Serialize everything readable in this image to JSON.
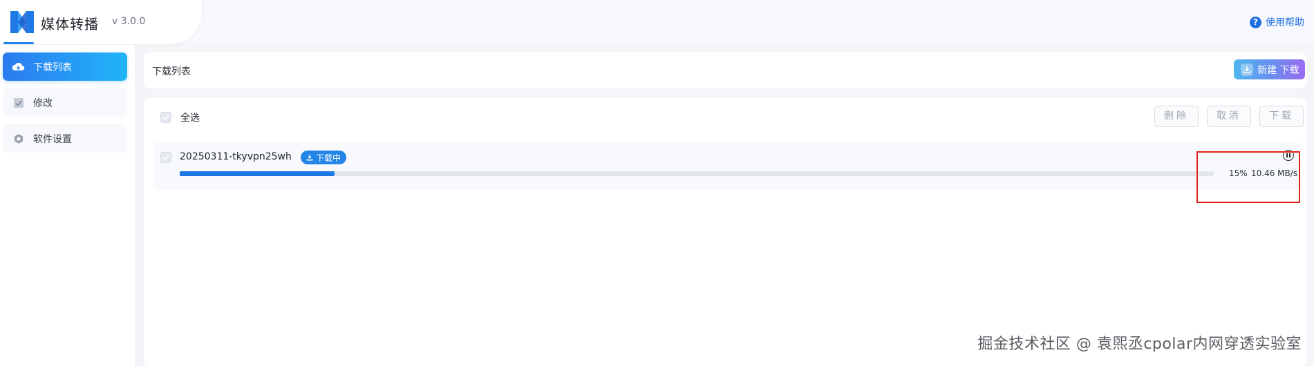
{
  "app": {
    "name": "媒体转播",
    "version": "v 3.0.0",
    "help_label": "使用帮助",
    "accent_color": "#1c86ee"
  },
  "sidebar": {
    "items": [
      {
        "label": "下载列表",
        "icon": "cloud-download-icon",
        "active": true
      },
      {
        "label": "修改",
        "icon": "edit-box-icon",
        "active": false
      },
      {
        "label": "软件设置",
        "icon": "gear-icon",
        "active": false
      }
    ]
  },
  "main": {
    "title": "下载列表",
    "new_download_label": "新建 下载",
    "select_all_label": "全选",
    "actions": {
      "delete_label": "删除",
      "cancel_label": "取消",
      "download_label": "下载"
    },
    "downloads": [
      {
        "name": "20250311-tkyvpn25wh",
        "status": "下载中",
        "progress_percent": 15,
        "progress_label": "15%",
        "speed": "10.46 MB/s"
      }
    ]
  },
  "watermark": "掘金技术社区 @ 袁煕丞cpolar内网穿透实验室"
}
